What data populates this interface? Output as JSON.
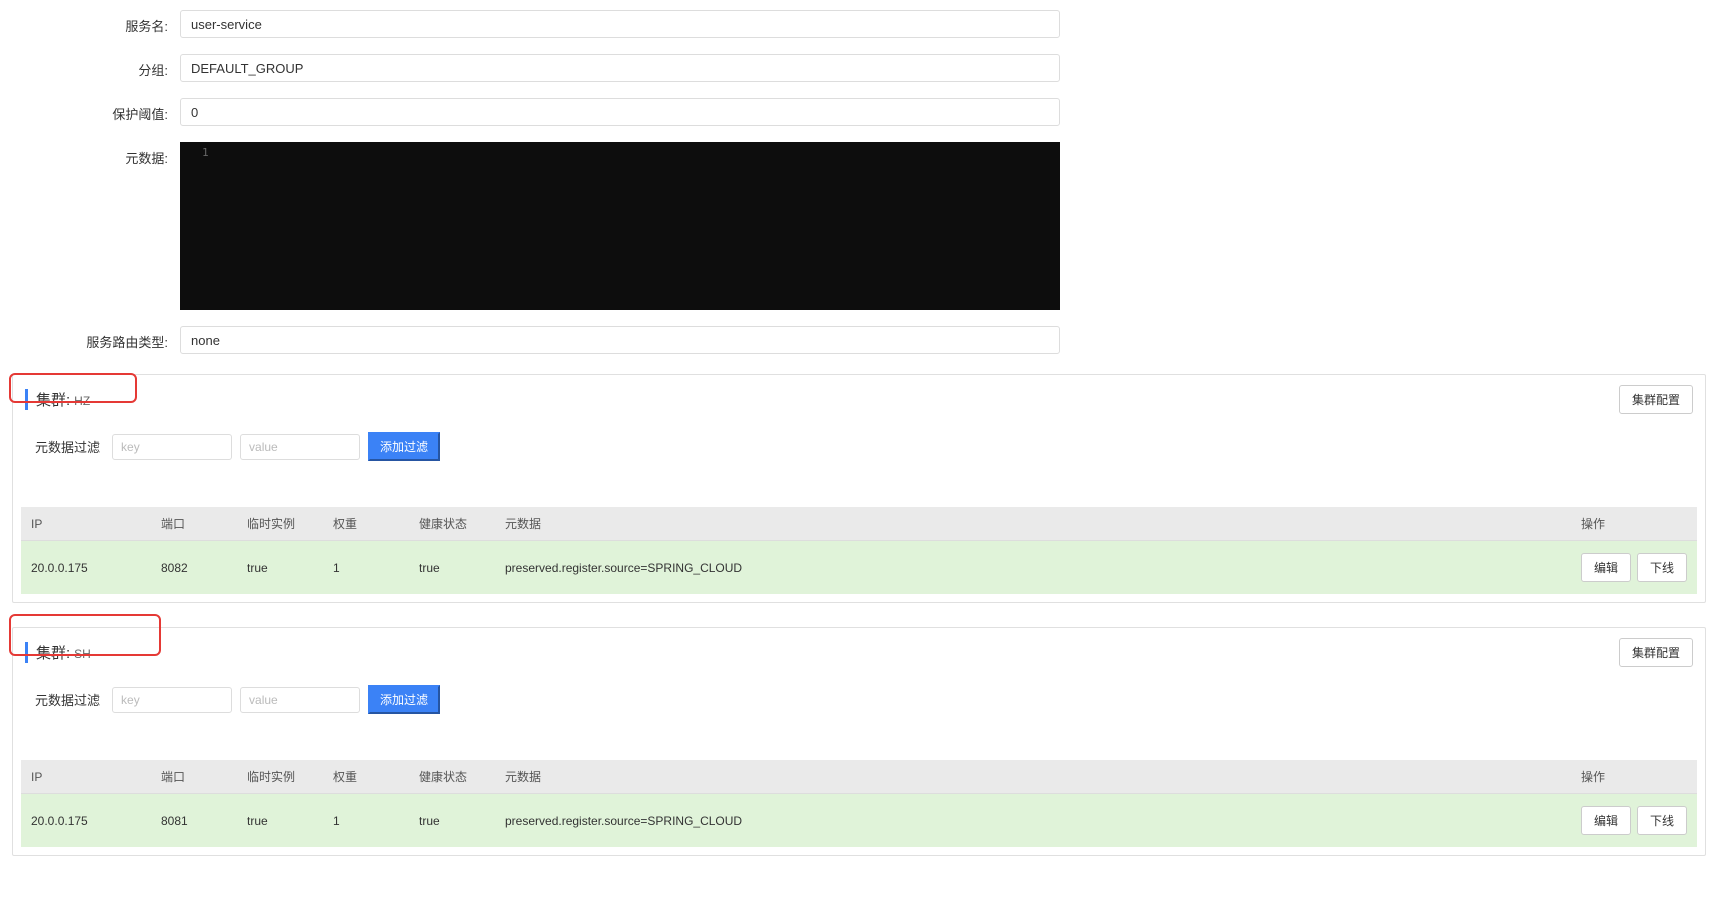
{
  "form": {
    "labels": {
      "service_name": "服务名:",
      "group": "分组:",
      "protect_threshold": "保护阈值:",
      "metadata": "元数据:",
      "route_type": "服务路由类型:"
    },
    "values": {
      "service_name": "user-service",
      "group": "DEFAULT_GROUP",
      "protect_threshold": "0",
      "route_type": "none"
    },
    "editor_line_num": "1"
  },
  "cluster_label": "集群:",
  "cluster_config_btn": "集群配置",
  "filter": {
    "label": "元数据过滤",
    "key_placeholder": "key",
    "value_placeholder": "value",
    "add_btn": "添加过滤"
  },
  "table_headers": {
    "ip": "IP",
    "port": "端口",
    "temp": "临时实例",
    "weight": "权重",
    "health": "健康状态",
    "meta": "元数据",
    "ops": "操作"
  },
  "ops": {
    "edit": "编辑",
    "offline": "下线"
  },
  "clusters": [
    {
      "name": "HZ",
      "rows": [
        {
          "ip": "20.0.0.175",
          "port": "8082",
          "temp": "true",
          "weight": "1",
          "health": "true",
          "meta": "preserved.register.source=SPRING_CLOUD"
        }
      ]
    },
    {
      "name": "SH",
      "rows": [
        {
          "ip": "20.0.0.175",
          "port": "8081",
          "temp": "true",
          "weight": "1",
          "health": "true",
          "meta": "preserved.register.source=SPRING_CLOUD"
        }
      ]
    }
  ]
}
